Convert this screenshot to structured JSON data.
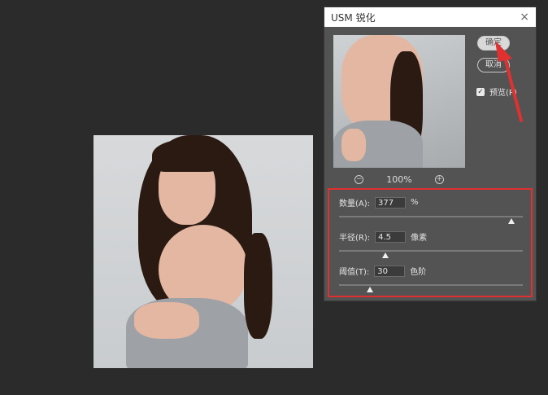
{
  "dialog": {
    "title": "USM 锐化",
    "close_symbol": "×",
    "ok_label": "确定",
    "cancel_label": "取消",
    "preview_label": "预览(P)",
    "preview_checked": true,
    "zoom_level": "100%"
  },
  "params": {
    "amount": {
      "label": "数量(A):",
      "value": "377",
      "unit": "%",
      "slider_fraction": 0.94
    },
    "radius": {
      "label": "半径(R):",
      "value": "4.5",
      "unit": "像素",
      "slider_fraction": 0.25
    },
    "threshold": {
      "label": "阈值(T):",
      "value": "30",
      "unit": "色阶",
      "slider_fraction": 0.17
    }
  },
  "colors": {
    "background": "#2b2b2b",
    "dialog_bg": "#535353",
    "highlight_red": "#e03030"
  },
  "icons": [
    "close-icon",
    "zoom-out-icon",
    "zoom-in-icon",
    "checkbox-check-icon",
    "annotation-arrow-icon"
  ]
}
